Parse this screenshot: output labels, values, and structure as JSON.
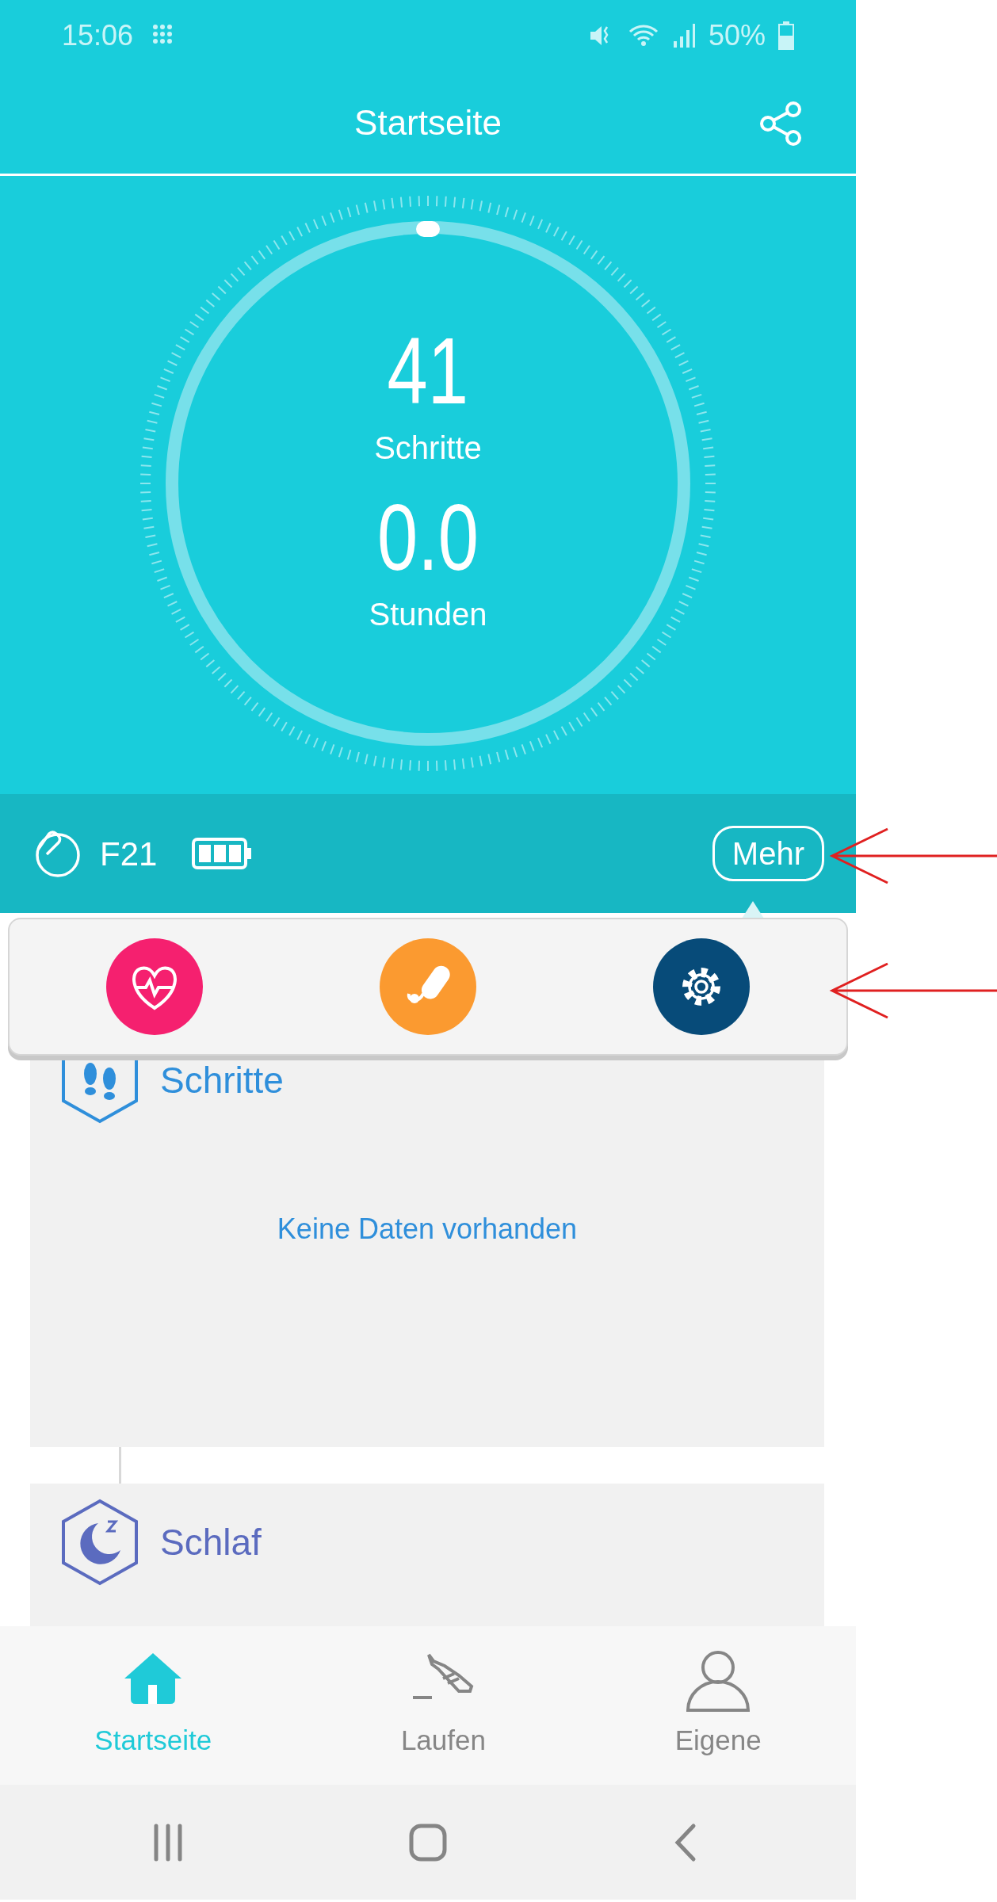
{
  "status_bar": {
    "time": "15:06",
    "battery": "50%"
  },
  "header": {
    "title": "Startseite"
  },
  "summary": {
    "steps_value": "41",
    "steps_label": "Schritte",
    "hours_value": "0.0",
    "hours_label": "Stunden"
  },
  "device_bar": {
    "device_name": "F21",
    "more_button": "Mehr"
  },
  "popup_menu": [
    {
      "kind": "heart",
      "color": "#f5206f"
    },
    {
      "kind": "pill",
      "color": "#fb9a30"
    },
    {
      "kind": "settings",
      "color": "#074b79"
    }
  ],
  "cards": [
    {
      "kind": "steps",
      "title": "Schritte",
      "color": "#2f8fdb",
      "message": "Keine Daten vorhanden"
    },
    {
      "kind": "sleep",
      "title": "Schlaf",
      "color": "#5b6bbf"
    }
  ],
  "bottom_nav": [
    {
      "kind": "home",
      "label": "Startseite",
      "selected": true
    },
    {
      "kind": "run",
      "label": "Laufen",
      "selected": false
    },
    {
      "kind": "profile",
      "label": "Eigene",
      "selected": false
    }
  ]
}
